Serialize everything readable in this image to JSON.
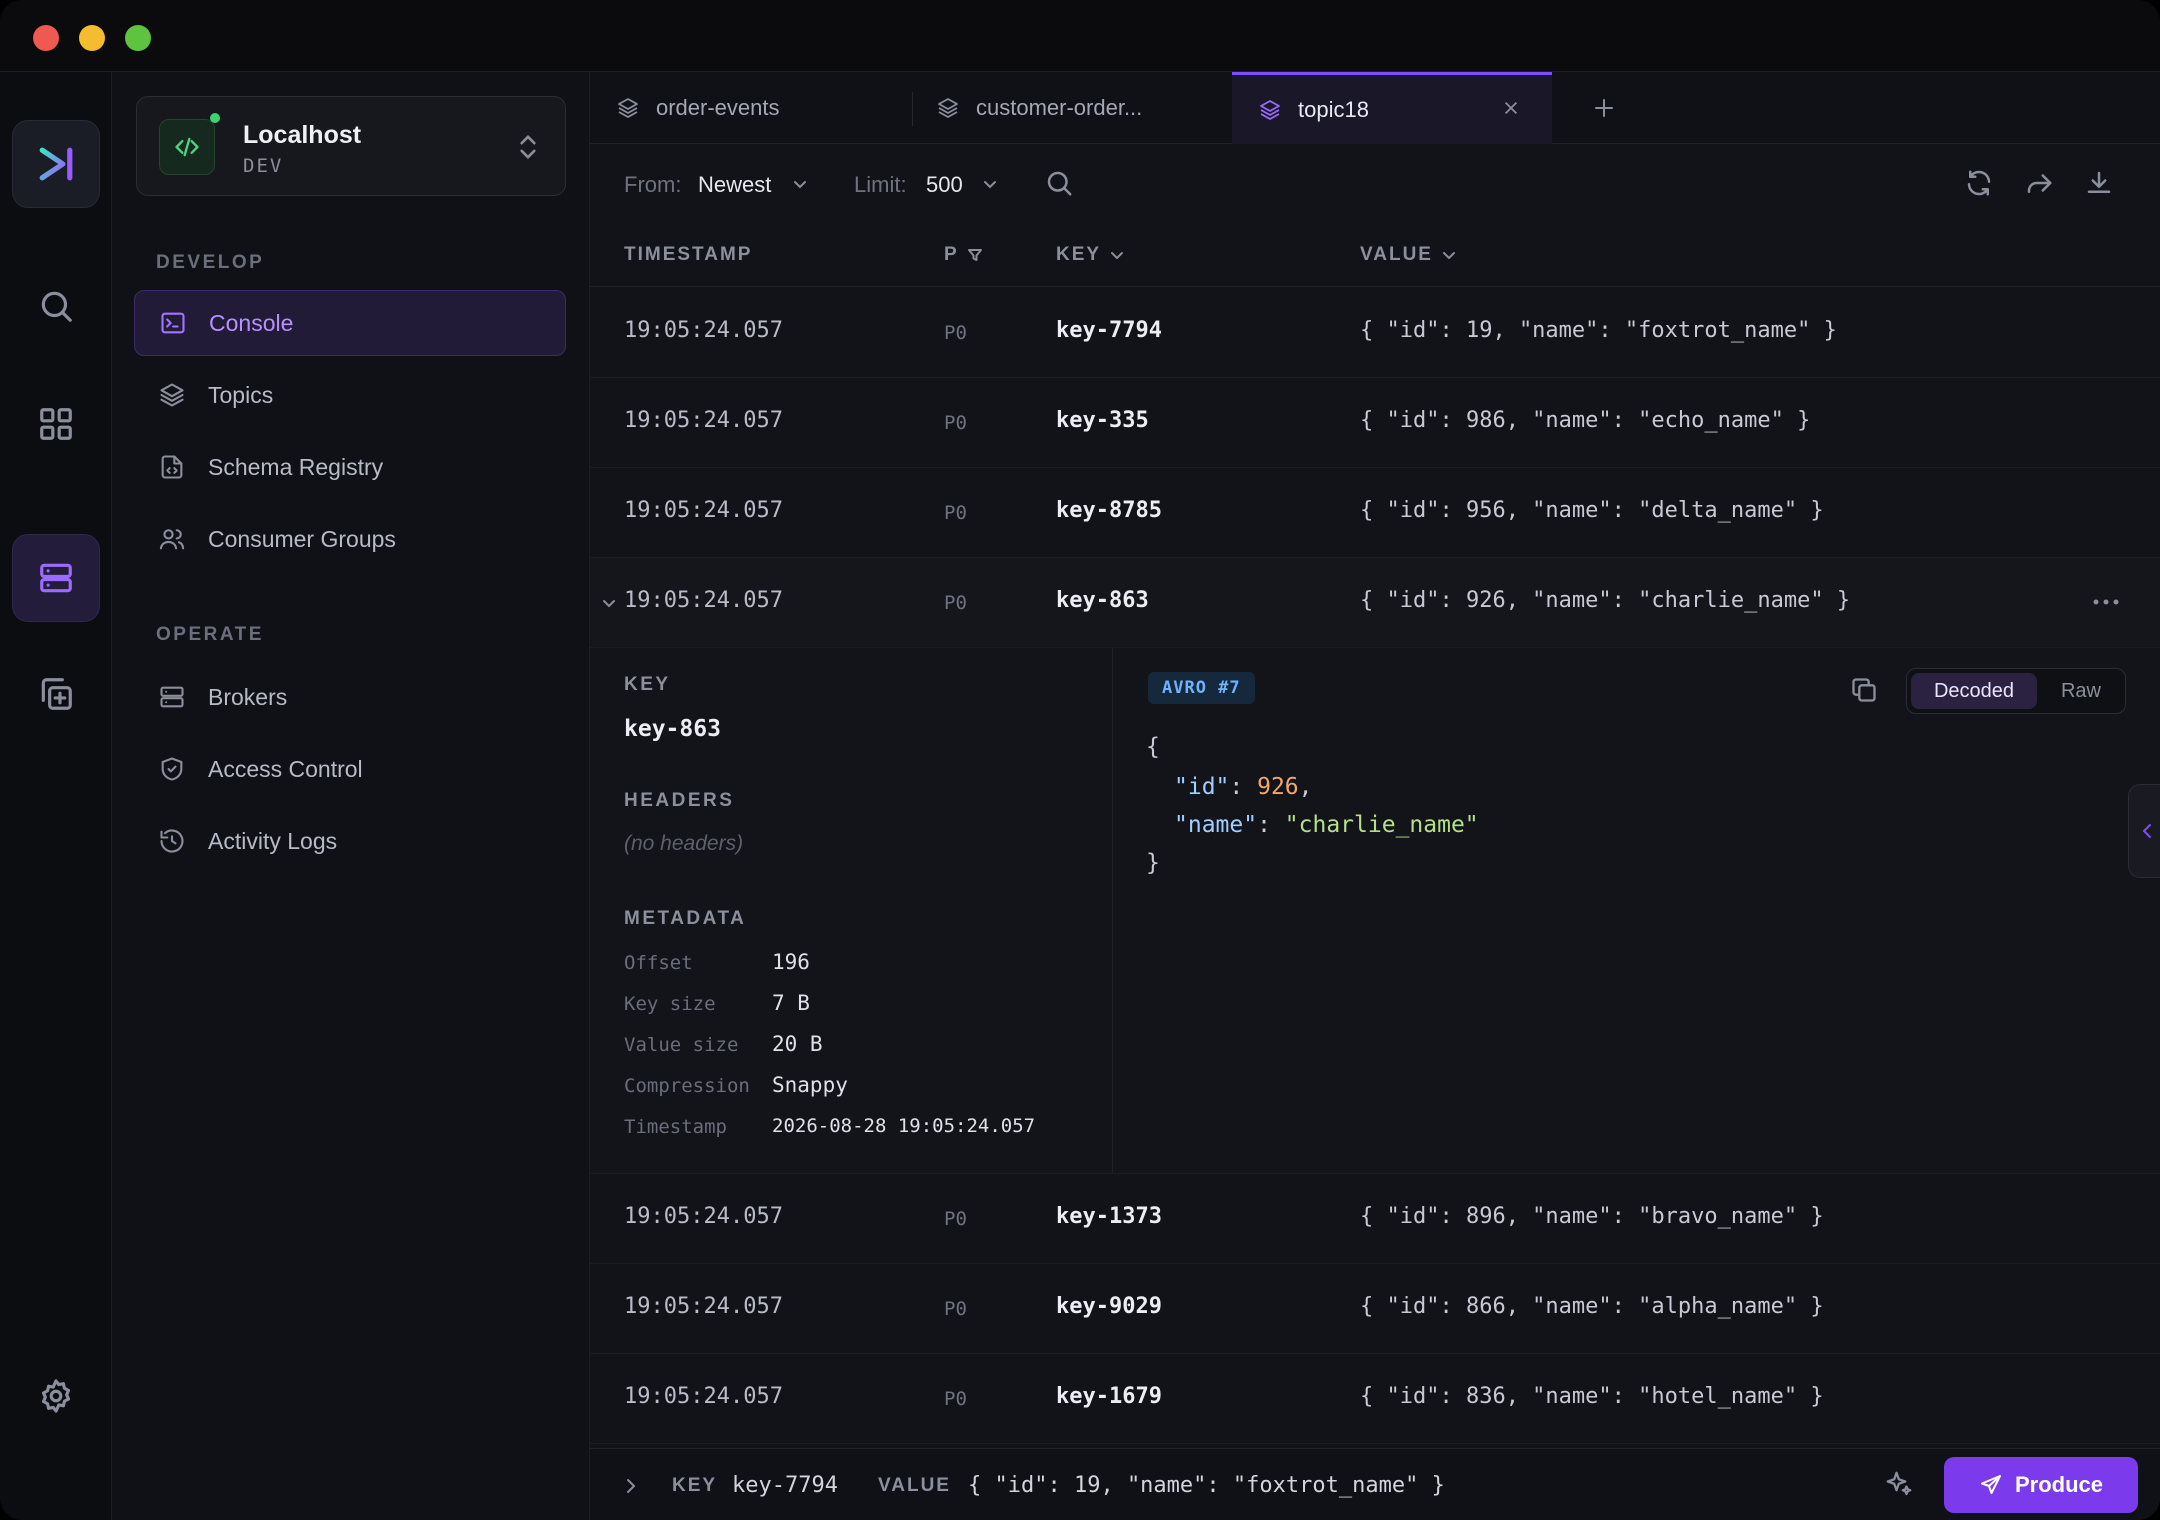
{
  "window": {
    "controls": [
      "close",
      "minimize",
      "maximize"
    ]
  },
  "rail": {
    "items": [
      "app-logo",
      "search-icon",
      "grid-icon",
      "server-icon",
      "add-copy-icon",
      "gear-icon"
    ],
    "active": "server-icon"
  },
  "environment": {
    "name": "Localhost",
    "tag": "DEV",
    "status_color": "#3bd46f"
  },
  "sidebar": {
    "develop_label": "DEVELOP",
    "operate_label": "OPERATE",
    "develop_items": [
      {
        "label": "Console",
        "icon": "terminal-icon",
        "active": true
      },
      {
        "label": "Topics",
        "icon": "layers-icon"
      },
      {
        "label": "Schema Registry",
        "icon": "file-code-icon"
      },
      {
        "label": "Consumer Groups",
        "icon": "users-icon"
      }
    ],
    "operate_items": [
      {
        "label": "Brokers",
        "icon": "server-icon"
      },
      {
        "label": "Access Control",
        "icon": "shield-icon"
      },
      {
        "label": "Activity Logs",
        "icon": "history-icon"
      }
    ]
  },
  "tabs": [
    {
      "label": "order-events",
      "icon": "layers-icon"
    },
    {
      "label": "customer-order...",
      "icon": "layers-icon"
    },
    {
      "label": "topic18",
      "icon": "layers-icon",
      "active": true
    }
  ],
  "toolbar": {
    "from_label": "From:",
    "from_value": "Newest",
    "limit_label": "Limit:",
    "limit_value": "500"
  },
  "columns": {
    "timestamp": "TIMESTAMP",
    "partition": "P",
    "key": "KEY",
    "value": "VALUE"
  },
  "rows": [
    {
      "timestamp": "19:05:24.057",
      "partition": "P0",
      "key": "key-7794",
      "value": "{ \"id\": 19, \"name\": \"foxtrot_name\" }"
    },
    {
      "timestamp": "19:05:24.057",
      "partition": "P0",
      "key": "key-335",
      "value": "{ \"id\": 986, \"name\": \"echo_name\" }"
    },
    {
      "timestamp": "19:05:24.057",
      "partition": "P0",
      "key": "key-8785",
      "value": "{ \"id\": 956, \"name\": \"delta_name\" }"
    },
    {
      "timestamp": "19:05:24.057",
      "partition": "P0",
      "key": "key-863",
      "value": "{ \"id\": 926, \"name\": \"charlie_name\" }",
      "expanded": true
    },
    {
      "timestamp": "19:05:24.057",
      "partition": "P0",
      "key": "key-1373",
      "value": "{ \"id\": 896, \"name\": \"bravo_name\" }"
    },
    {
      "timestamp": "19:05:24.057",
      "partition": "P0",
      "key": "key-9029",
      "value": "{ \"id\": 866, \"name\": \"alpha_name\" }"
    },
    {
      "timestamp": "19:05:24.057",
      "partition": "P0",
      "key": "key-1679",
      "value": "{ \"id\": 836, \"name\": \"hotel_name\" }"
    }
  ],
  "detail": {
    "key_label": "KEY",
    "key_value": "key-863",
    "headers_label": "HEADERS",
    "headers_empty": "(no headers)",
    "metadata_label": "METADATA",
    "metadata": [
      {
        "k": "Offset",
        "v": "196"
      },
      {
        "k": "Key size",
        "v": "7 B"
      },
      {
        "k": "Value size",
        "v": "20 B"
      },
      {
        "k": "Compression",
        "v": "Snappy"
      },
      {
        "k": "Timestamp",
        "v": "2026-08-28 19:05:24.057"
      }
    ],
    "badge": "AVRO #7",
    "view_decoded": "Decoded",
    "view_raw": "Raw",
    "json": {
      "open": "{",
      "id_key": "\"id\"",
      "id_value": "926",
      "name_key": "\"name\"",
      "name_value": "\"charlie_name\"",
      "close": "}"
    }
  },
  "footer": {
    "key_label": "KEY",
    "key_value": "key-7794",
    "value_label": "VALUE",
    "value_value": "{ \"id\": 19, \"name\": \"foxtrot_name\" }",
    "produce_label": "Produce"
  },
  "colors": {
    "accent": "#7c3aed",
    "active_text": "#b790ff",
    "badge": "#6fb2ff",
    "json_number": "#f0a86a",
    "json_string": "#b4e08a"
  }
}
